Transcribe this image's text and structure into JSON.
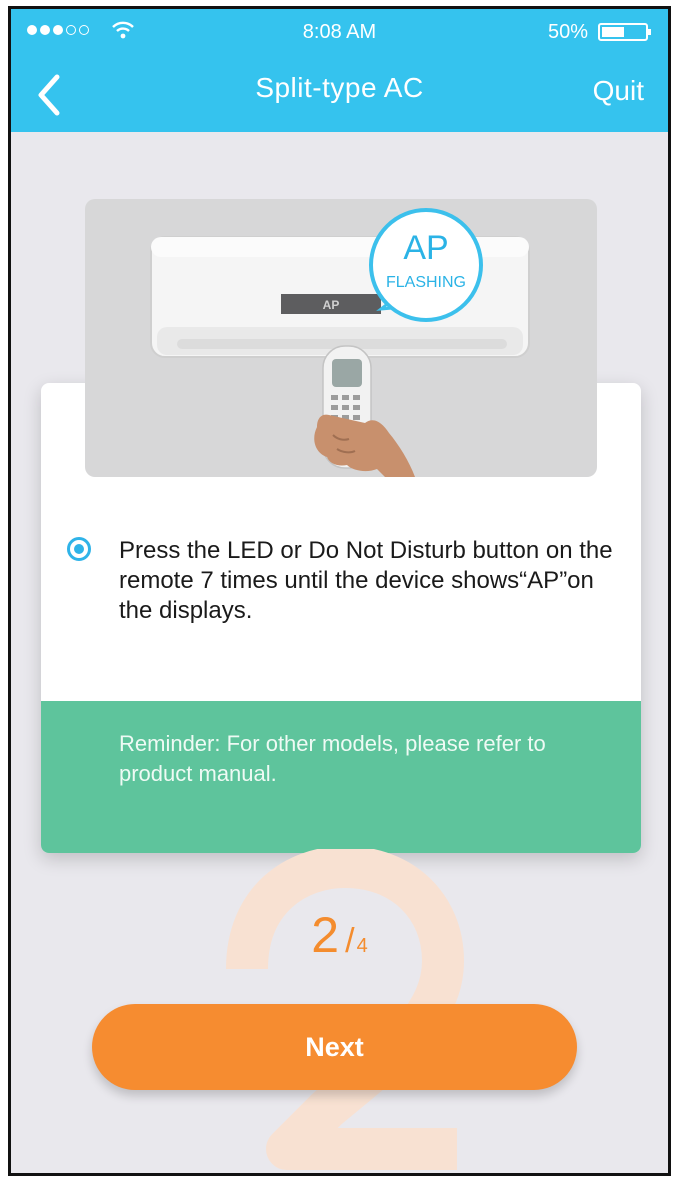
{
  "status_bar": {
    "time": "8:08 AM",
    "battery": "50%"
  },
  "nav": {
    "title": "Split-type AC",
    "quit_label": "Quit"
  },
  "illustration": {
    "display_text": "AP",
    "bubble_title": "AP",
    "bubble_subtitle": "FLASHING"
  },
  "card": {
    "instruction": "Press the LED or Do Not Disturb button on the remote 7 times until the device shows“AP”on the displays.",
    "reminder": "Reminder: For other models, please refer to product manual."
  },
  "progress": {
    "current": "2",
    "separator": "/",
    "total": "4"
  },
  "next_label": "Next",
  "colors": {
    "header": "#35c3ee",
    "accent": "#f68c30",
    "reminder": "#5ec49c",
    "radio": "#2fb3e8"
  }
}
